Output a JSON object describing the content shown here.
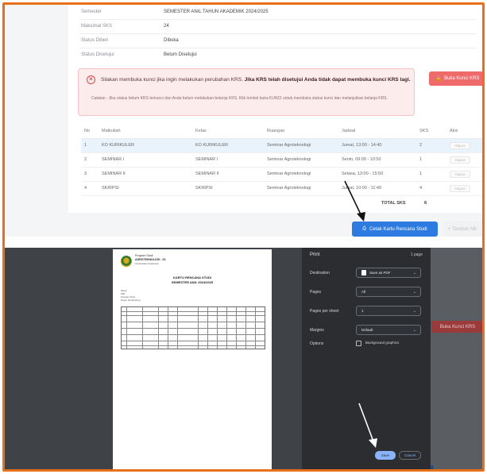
{
  "krs": {
    "info": [
      {
        "label": "Semester",
        "value": "SEMESTER ANIL TAHUN AKADEMIK 2024/2025"
      },
      {
        "label": "Maksimal SKS",
        "value": "24"
      },
      {
        "label": "Status Diberi",
        "value": "Dibuka"
      },
      {
        "label": "Status Disetujui",
        "value": "Belum Disetujui"
      }
    ],
    "alert_title_plain": "Silakan membuka kunci jika ingin melakukan perubahan KRS.",
    "alert_title_bold": "Jika KRS telah disetujui Anda tidak dapat membuka kunci KRS lagi.",
    "alert_note": "Catatan : Jika status belum KRS terkunci dan Anda belum melakukan belanja KRS. Klik tombol buka KUNCI untuk membuka status kunci dan melanjutkan belanja KRS.",
    "unlock_button": "Buka Kunci KRS",
    "columns": [
      "No",
      "Matkuliah",
      "Kelas",
      "Ruangan",
      "Jadwal",
      "SKS",
      "Aksi"
    ],
    "rows": [
      {
        "no": "1",
        "mk": "KO KURIKULER",
        "kelas": "KO KURIKULER",
        "ruang": "Seminar Agroteknologi",
        "jadwal": "Jumat, 13:00 - 14:40",
        "sks": "2",
        "aksi": "Hapus"
      },
      {
        "no": "2",
        "mk": "SEMINAR I",
        "kelas": "SEMINAR I",
        "ruang": "Seminar Agroteknologi",
        "jadwal": "Senin, 09:00 - 10:50",
        "sks": "1",
        "aksi": "Hapus"
      },
      {
        "no": "3",
        "mk": "SEMINAR II",
        "kelas": "SEMINAR II",
        "ruang": "Seminar Agroteknologi",
        "jadwal": "Selasa, 13:00 - 15:50",
        "sks": "1",
        "aksi": "Hapus"
      },
      {
        "no": "4",
        "mk": "SKRIPSI",
        "kelas": "SKRIPSI",
        "ruang": "Seminar Agroteknologi",
        "jadwal": "Jumat, 10:00 - 11:40",
        "sks": "4",
        "aksi": "Hapus"
      }
    ],
    "total_label": "TOTAL SKS",
    "total_value": "8",
    "print_button": "Cetak Kartu Rencana Studi",
    "add_button": "Tambah Mk"
  },
  "preview": {
    "inst_line1": "Program Studi",
    "inst_line2": "AGROTEKNOLOGI - S1",
    "inst_line3": "Universitas Nusantara",
    "title_line1": "KARTU RENCANA STUDI",
    "title_line2": "SEMESTER ANIL 2024/2025",
    "fields": [
      "Nama",
      "NIM",
      "Program Studi",
      "Dosen Pembimbing"
    ]
  },
  "print_dialog": {
    "title": "Print",
    "page_count": "1 page",
    "destination_label": "Destination",
    "destination_value": "Save as PDF",
    "pages_label": "Pages",
    "pages_value": "All",
    "pages_per_sheet_label": "Pages per sheet",
    "pages_per_sheet_value": "1",
    "margins_label": "Margins",
    "margins_value": "Default",
    "options_label": "Options",
    "background_graphics": "Background graphics",
    "save_button": "Save",
    "cancel_button": "Cancel"
  },
  "background": {
    "unlock_button": "Buka Kunci KRS"
  },
  "colors": {
    "frame": "#e8701a",
    "primary": "#2d7be0",
    "danger": "#ef6a6a"
  }
}
